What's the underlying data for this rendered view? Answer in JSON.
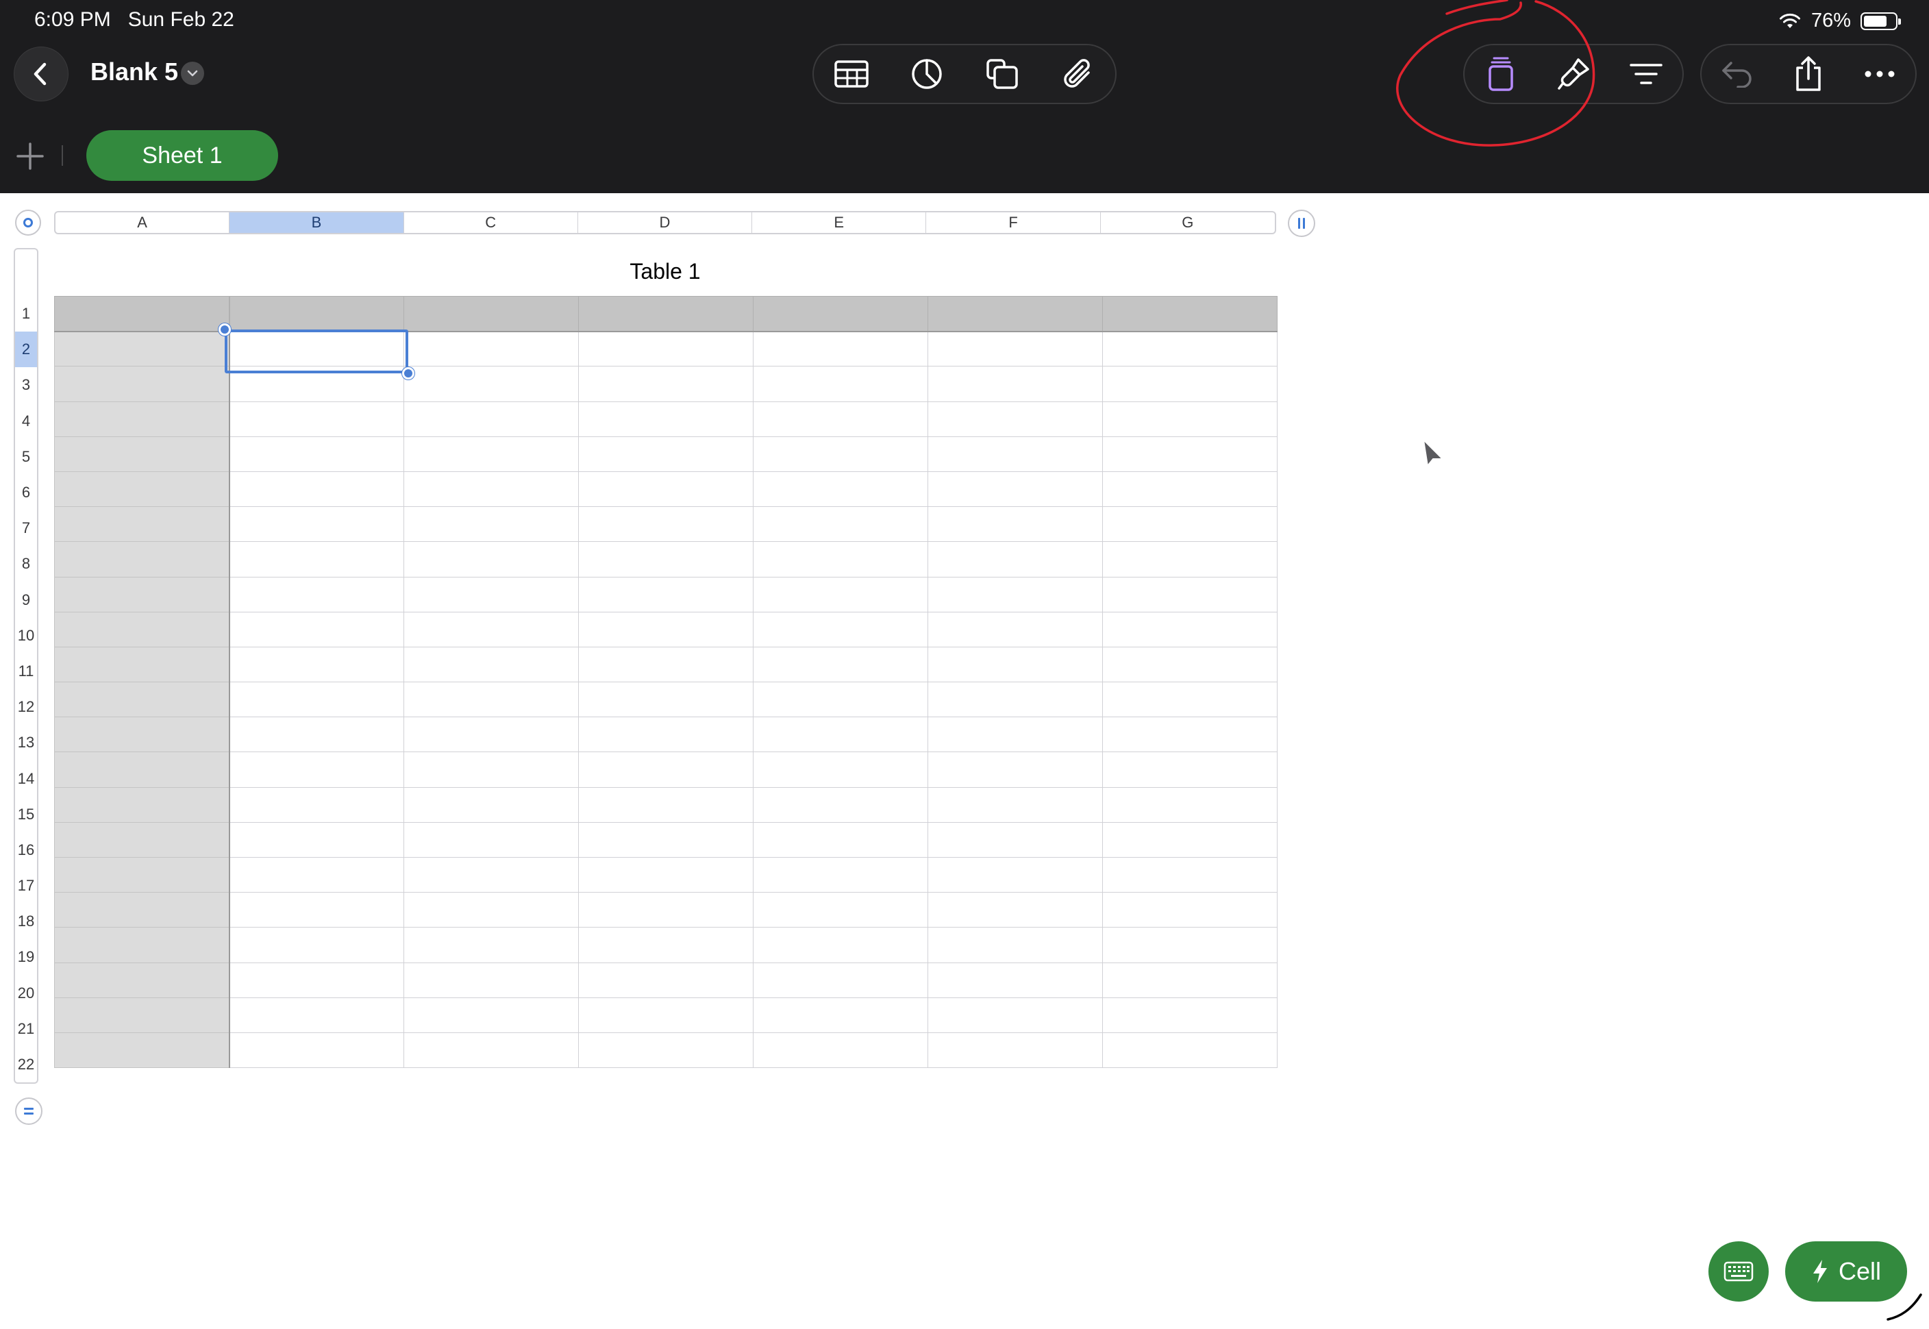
{
  "status_bar": {
    "time_date": "6:09 PM   Sun Feb 22",
    "battery_percent": "76%",
    "battery_level": 0.76
  },
  "header": {
    "back_icon": "chevron-left-icon",
    "document_title": "Blank 5",
    "title_menu_icon": "chevron-down-icon"
  },
  "toolbar": {
    "insert_group": [
      {
        "name": "table-icon"
      },
      {
        "name": "chart-icon"
      },
      {
        "name": "shape-icon"
      },
      {
        "name": "attachment-icon"
      }
    ],
    "format_group": [
      {
        "name": "format-icon",
        "color": "#b78cff"
      },
      {
        "name": "paintbrush-icon"
      },
      {
        "name": "organize-icon"
      }
    ],
    "actions_group": [
      {
        "name": "undo-icon",
        "enabled": false
      },
      {
        "name": "share-icon"
      },
      {
        "name": "more-icon"
      }
    ]
  },
  "sheets": {
    "add_icon": "plus-icon",
    "tabs": [
      {
        "label": "Sheet 1",
        "active": true
      }
    ]
  },
  "table": {
    "title": "Table 1",
    "columns": [
      "A",
      "B",
      "C",
      "D",
      "E",
      "F",
      "G"
    ],
    "rows": [
      "1",
      "2",
      "3",
      "4",
      "5",
      "6",
      "7",
      "8",
      "9",
      "10",
      "11",
      "12",
      "13",
      "14",
      "15",
      "16",
      "17",
      "18",
      "19",
      "20",
      "21",
      "22"
    ],
    "selected_cell": "B2",
    "selected_column": "B",
    "selected_row": "2",
    "header_rows": 1,
    "header_columns": 1
  },
  "bottom_buttons": {
    "keyboard_icon": "keyboard-icon",
    "cell_icon": "lightning-icon",
    "cell_label": "Cell"
  },
  "colors": {
    "chrome_bg": "#1c1c1e",
    "accent_green": "#338a3e",
    "selection_blue": "#4a7fd4",
    "annotation_red": "#e0242f"
  }
}
